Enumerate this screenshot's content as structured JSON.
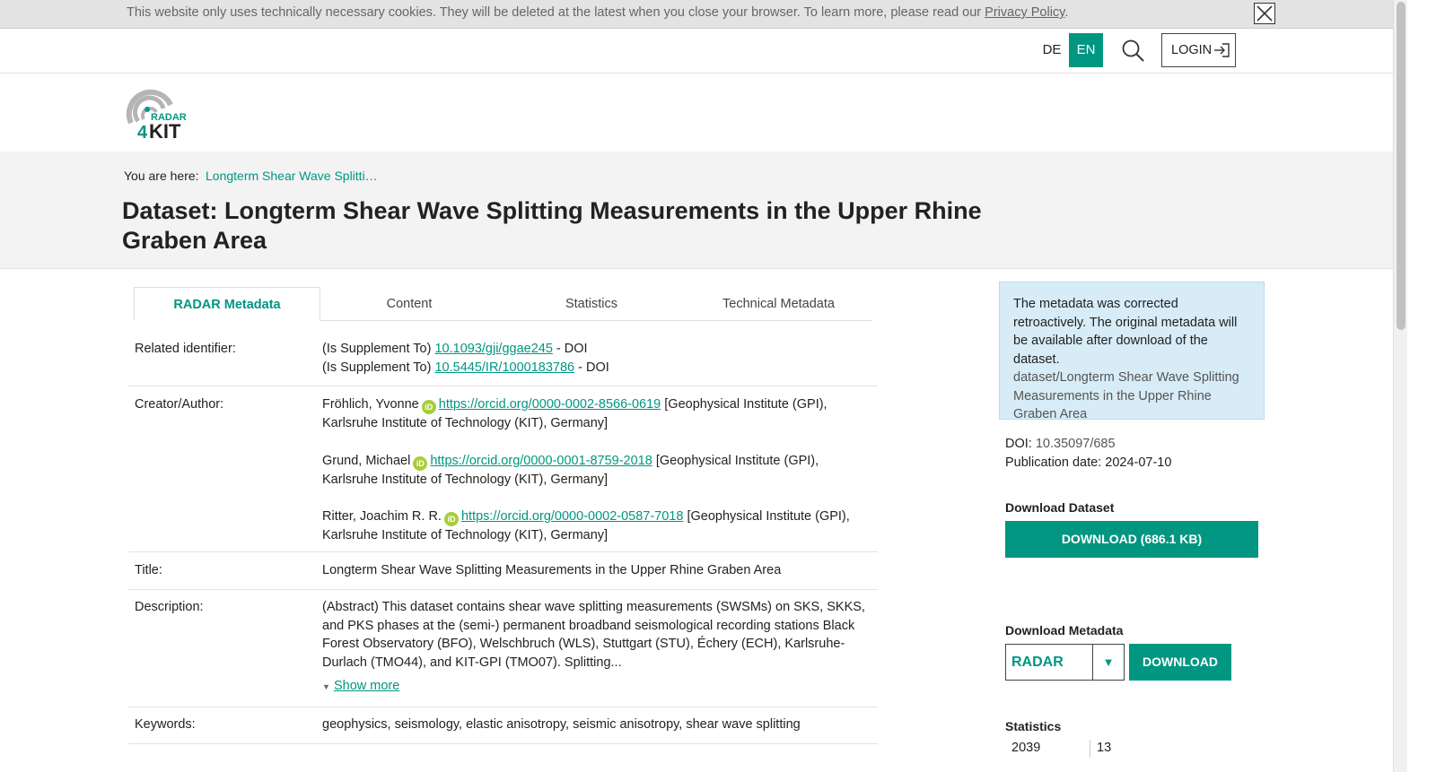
{
  "cookie": {
    "text": "This website only uses technically necessary cookies. They will be deleted at the latest when you close your browser. To learn more, please read our ",
    "link": "Privacy Policy",
    "end": "."
  },
  "nav": {
    "lang_de": "DE",
    "lang_en": "EN",
    "login": "LOGIN"
  },
  "logo": {
    "line1": "RADAR",
    "num": "4",
    "line2": "KIT"
  },
  "breadcrumb": {
    "label": "You are here:",
    "item": "Longterm Shear Wave Splitti…"
  },
  "title": "Dataset: Longterm Shear Wave Splitting Measurements in the Upper Rhine Graben Area",
  "tabs": [
    {
      "label": "RADAR Metadata"
    },
    {
      "label": "Content"
    },
    {
      "label": "Statistics"
    },
    {
      "label": "Technical Metadata"
    }
  ],
  "metadata": {
    "related": {
      "label": "Related identifier:",
      "items": [
        {
          "prefix": "(Is Supplement To) ",
          "link": "10.1093/gji/ggae245",
          "suffix": " - DOI"
        },
        {
          "prefix": "(Is Supplement To) ",
          "link": "10.5445/IR/1000183786",
          "suffix": " - DOI"
        }
      ]
    },
    "creator": {
      "label": "Creator/Author:",
      "items": [
        {
          "name": "Fröhlich, Yvonne",
          "orcid": "https://orcid.org/0000-0002-8566-0619",
          "affiliation": "[Geophysical Institute (GPI), Karlsruhe Institute of Technology (KIT), Germany]"
        },
        {
          "name": "Grund, Michael",
          "orcid": "https://orcid.org/0000-0001-8759-2018",
          "affiliation": "[Geophysical Institute (GPI), Karlsruhe Institute of Technology (KIT), Germany]"
        },
        {
          "name": "Ritter, Joachim R. R.",
          "orcid": "https://orcid.org/0000-0002-0587-7018",
          "affiliation": "[Geophysical Institute (GPI), Karlsruhe Institute of Technology (KIT), Germany]"
        }
      ]
    },
    "title": {
      "label": "Title:",
      "value": "Longterm Shear Wave Splitting Measurements in the Upper Rhine Graben Area"
    },
    "description": {
      "label": "Description:",
      "value": "(Abstract) This dataset contains shear wave splitting measurements (SWSMs) on SKS, SKKS, and PKS phases at the (semi-) permanent broadband seismological recording stations Black Forest Observatory (BFO), Welschbruch (WLS), Stuttgart (STU), Échery (ECH), Karlsruhe-Durlach (TMO44), and KIT-GPI (TMO07). Splitting...",
      "show_more": "Show more"
    },
    "keywords": {
      "label": "Keywords:",
      "value": "geophysics, seismology, elastic anisotropy, seismic anisotropy, shear wave splitting"
    }
  },
  "sidebar": {
    "notice": "The metadata was corrected retroactively. The original metadata will be available after download of the dataset.",
    "notice_path": "dataset/Longterm Shear Wave Splitting Measurements in the Upper Rhine Graben Area",
    "doi_label": "DOI: ",
    "doi_value": "10.35097/685",
    "pub_label": "Publication date: ",
    "pub_value": "2024-07-10",
    "download_heading": "Download Dataset",
    "download_button": "DOWNLOAD (686.1 KB)",
    "meta_heading": "Download Metadata",
    "meta_format": "RADAR",
    "meta_button": "DOWNLOAD",
    "stats_heading": "Statistics",
    "stats_year": "2039",
    "stats_count": "13"
  },
  "colors": {
    "accent": "#009682",
    "notice_bg": "#d7ecf7",
    "orcid": "#a6ce39"
  }
}
